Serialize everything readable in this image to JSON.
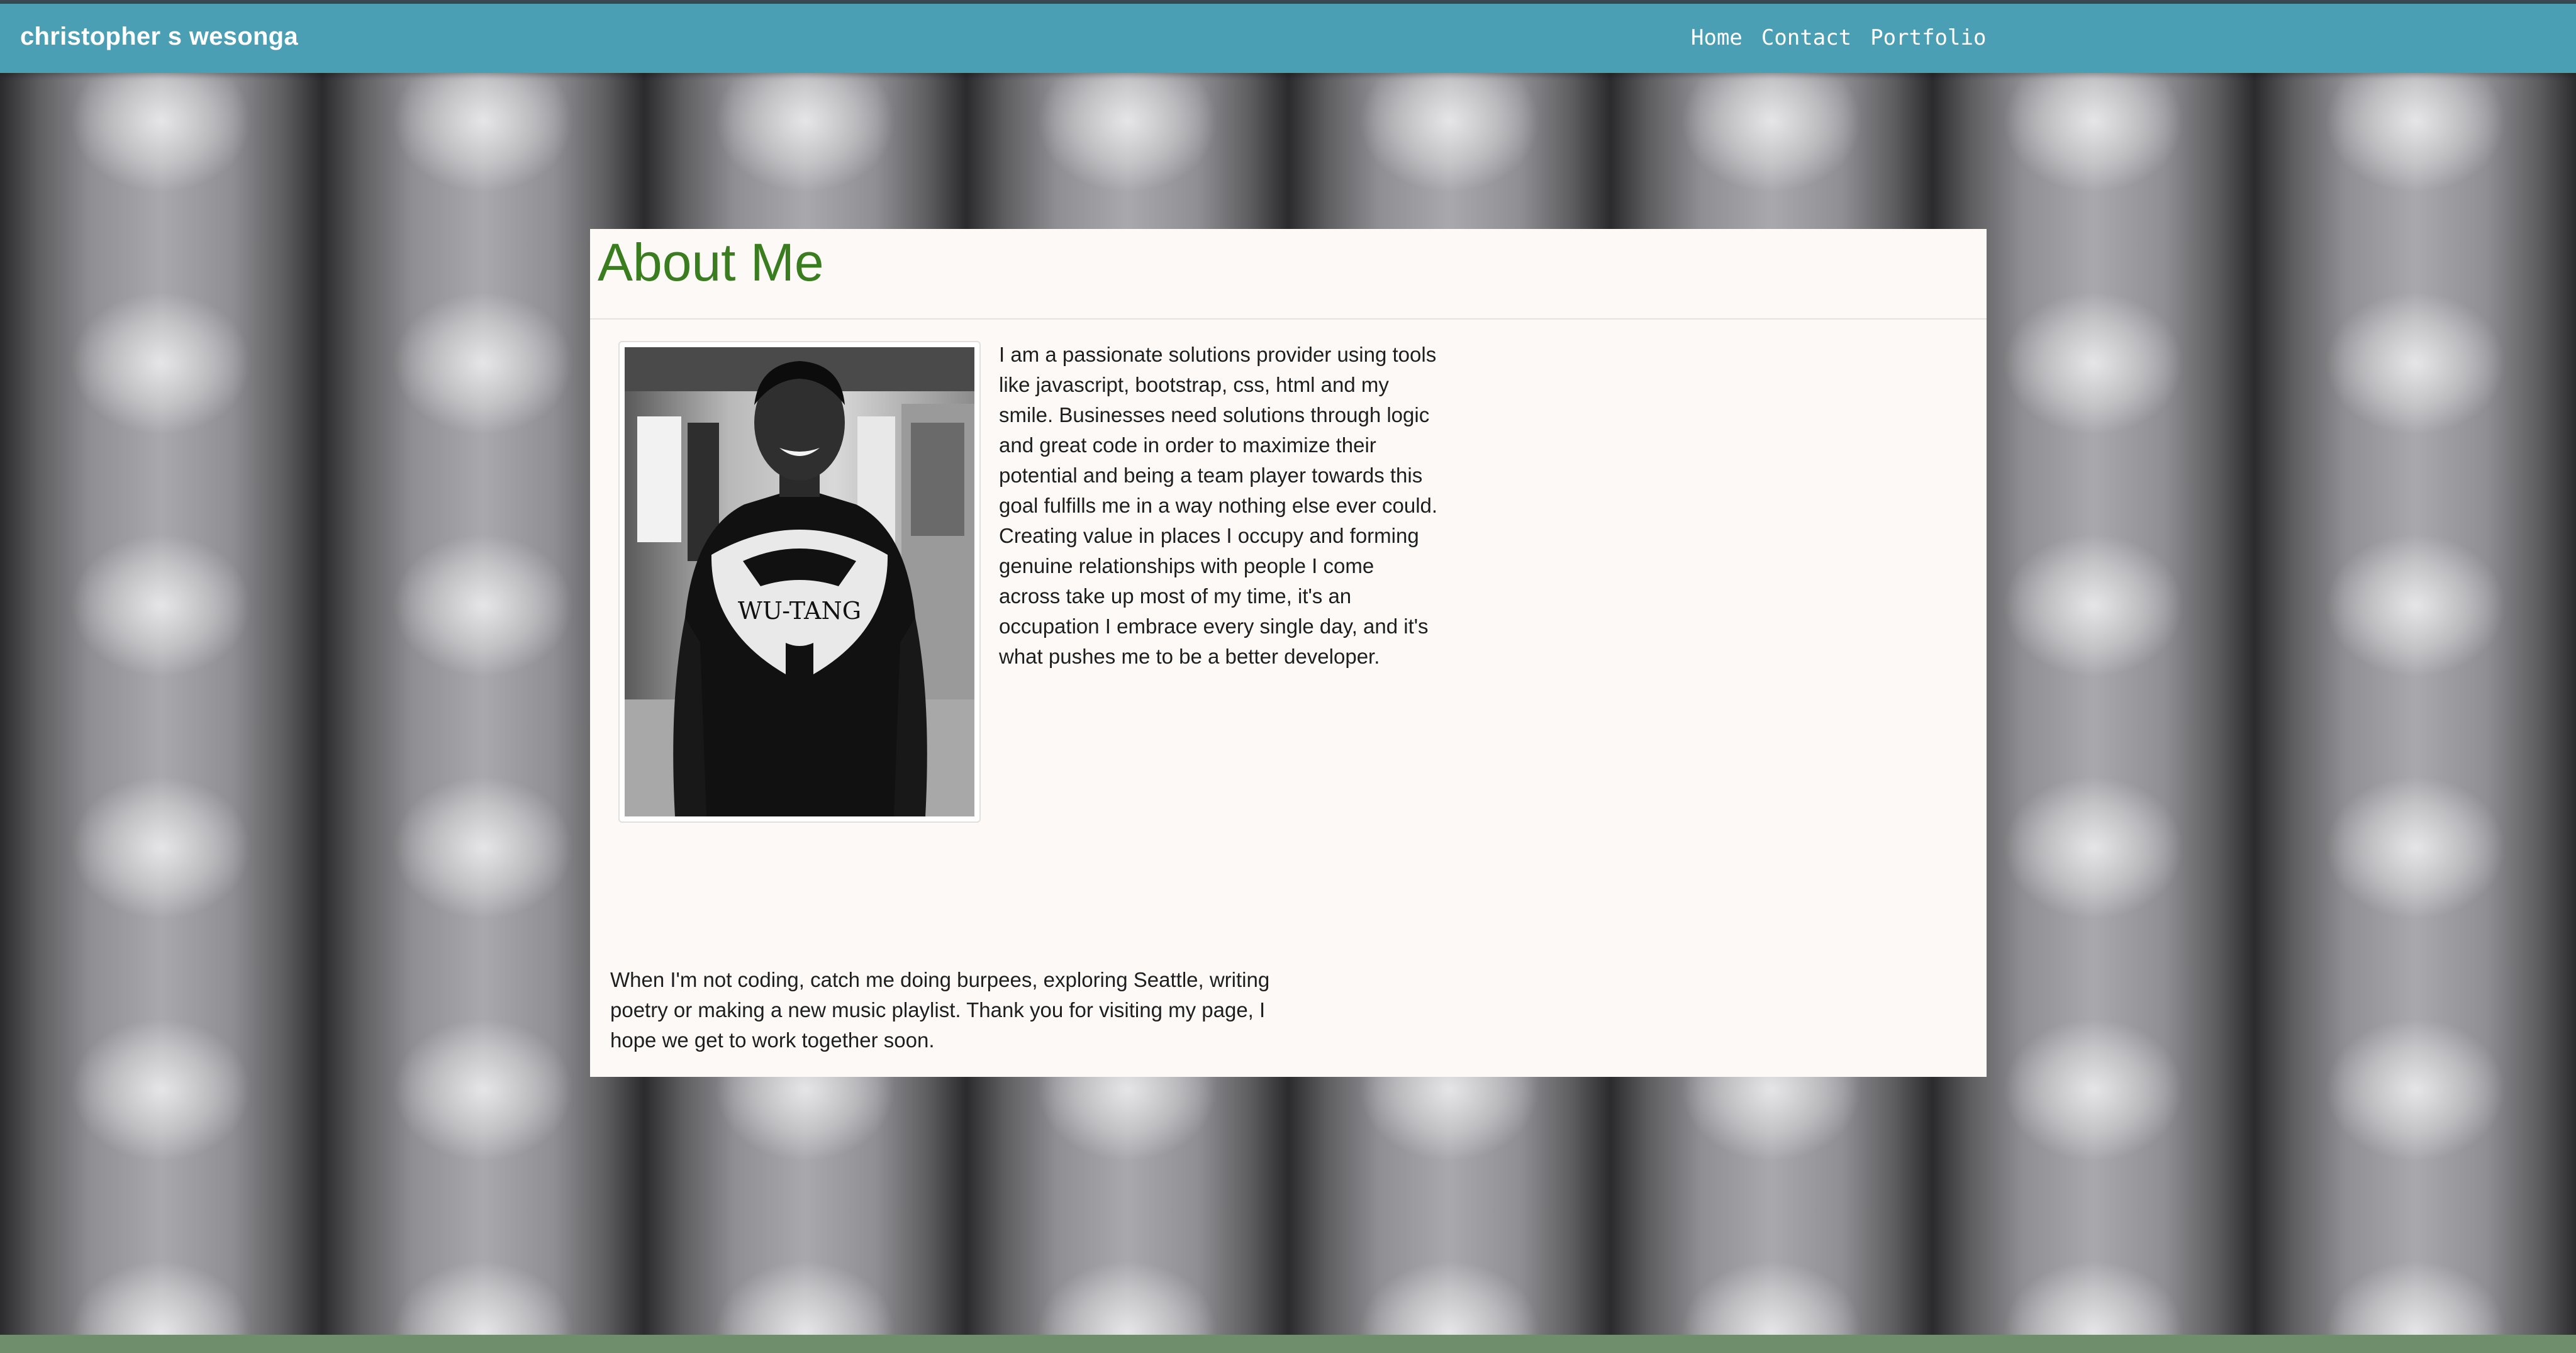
{
  "navbar": {
    "brand": "christopher s wesonga",
    "links": [
      "Home",
      "Contact",
      "Portfolio"
    ]
  },
  "about": {
    "title": "About Me",
    "photo_alt": "Portrait of Christopher wearing a Wu-Tang sweatshirt",
    "shirt_text": "WU-TANG",
    "bio": "I am a passionate solutions provider using tools like javascript, bootstrap, css, html and my smile. Businesses need solutions through logic and great code in order to maximize their potential and being a team player towards this goal fulfills me in a way nothing else ever could. Creating value in places I occupy and forming genuine relationships with people I come across take up most of my time, it's an occupation I embrace every single day, and it's what pushes me to be a better developer.",
    "outro": "When I'm not coding, catch me doing burpees, exploring Seattle, writing poetry or making a new music playlist. Thank you for visiting my page, I hope we get to work together soon."
  },
  "colors": {
    "navbar": "#4b9fb5",
    "title": "#3a7d1f",
    "card": "#fcf9f7",
    "footer": "#6e8e6c"
  }
}
